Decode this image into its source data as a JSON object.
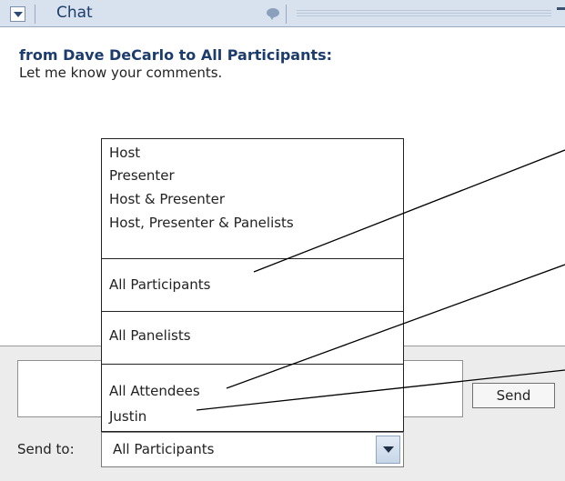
{
  "panel": {
    "title": "Chat",
    "icon": "chat-bubble-icon"
  },
  "message": {
    "sender": "from Dave DeCarlo to All Participants:",
    "text": "Let me know your comments."
  },
  "dropdown": {
    "groups": [
      [
        "Host",
        "Presenter",
        "Host & Presenter",
        "Host, Presenter & Panelists"
      ],
      [
        "All Participants"
      ],
      [
        "All Panelists"
      ],
      [
        "All Attendees",
        "Justin"
      ]
    ]
  },
  "compose": {
    "input_value": "",
    "send_label": "Send",
    "sendto_label": "Send to:",
    "sendto_value": "All Participants"
  },
  "colors": {
    "title": "#1c3c6e",
    "accent": "#d8e2ee"
  }
}
